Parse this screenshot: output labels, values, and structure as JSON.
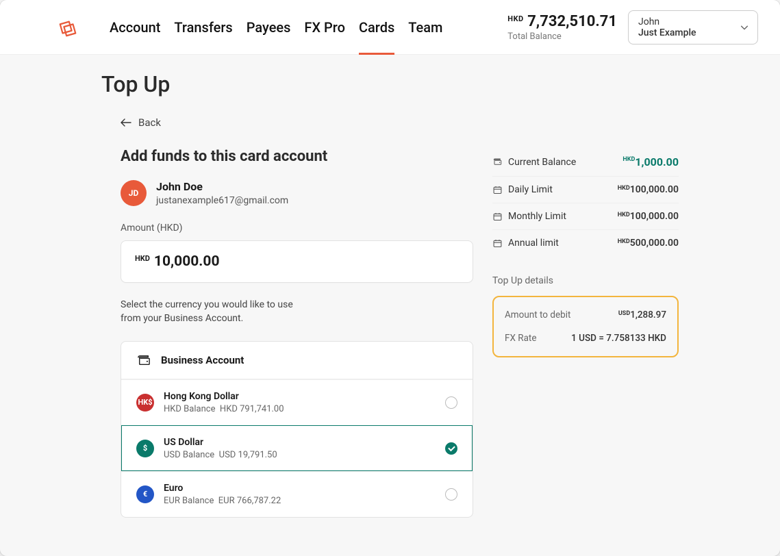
{
  "header": {
    "balance_ccy": "HKD",
    "balance_amount": "7,732,510.71",
    "balance_label": "Total Balance",
    "user_line1": "John",
    "user_line2": "Just Example"
  },
  "nav": {
    "items": [
      {
        "label": "Account",
        "active": false
      },
      {
        "label": "Transfers",
        "active": false
      },
      {
        "label": "Payees",
        "active": false
      },
      {
        "label": "FX Pro",
        "active": false
      },
      {
        "label": "Cards",
        "active": true
      },
      {
        "label": "Team",
        "active": false
      }
    ]
  },
  "page": {
    "title": "Top Up",
    "back_label": "Back",
    "section_heading": "Add funds to this card account"
  },
  "cardholder": {
    "initials": "JD",
    "name": "John Doe",
    "email": "justanexample617@gmail.com"
  },
  "amount": {
    "label": "Amount (HKD)",
    "ccy": "HKD",
    "value": "10,000.00"
  },
  "helper_text": "Select the currency you would like to use from your Business Account.",
  "account_source": {
    "header_label": "Business Account"
  },
  "currencies": [
    {
      "badge_text": "HK$",
      "badge_color": "#c93030",
      "name": "Hong Kong Dollar",
      "subline_label": "HKD Balance",
      "subline_value": "HKD 791,741.00",
      "selected": false
    },
    {
      "badge_text": "$",
      "badge_color": "#0a7a6a",
      "name": "US Dollar",
      "subline_label": "USD Balance",
      "subline_value": "USD 19,791.50",
      "selected": true
    },
    {
      "badge_text": "€",
      "badge_color": "#2356c6",
      "name": "Euro",
      "subline_label": "EUR Balance",
      "subline_value": "EUR 766,787.22",
      "selected": false
    }
  ],
  "limits": [
    {
      "icon": "wallet",
      "label": "Current Balance",
      "ccy": "HKD",
      "value": "1,000.00",
      "highlight": true
    },
    {
      "icon": "calendar",
      "label": "Daily Limit",
      "ccy": "HKD",
      "value": "100,000.00",
      "highlight": false
    },
    {
      "icon": "calendar",
      "label": "Monthly Limit",
      "ccy": "HKD",
      "value": "100,000.00",
      "highlight": false
    },
    {
      "icon": "calendar",
      "label": "Annual limit",
      "ccy": "HKD",
      "value": "500,000.00",
      "highlight": false
    }
  ],
  "details": {
    "title": "Top Up details",
    "rows": [
      {
        "label": "Amount to debit",
        "ccy": "USD",
        "value": "1,288.97"
      },
      {
        "label": "FX Rate",
        "ccy": "",
        "value": "1 USD = 7.758133 HKD"
      }
    ]
  }
}
